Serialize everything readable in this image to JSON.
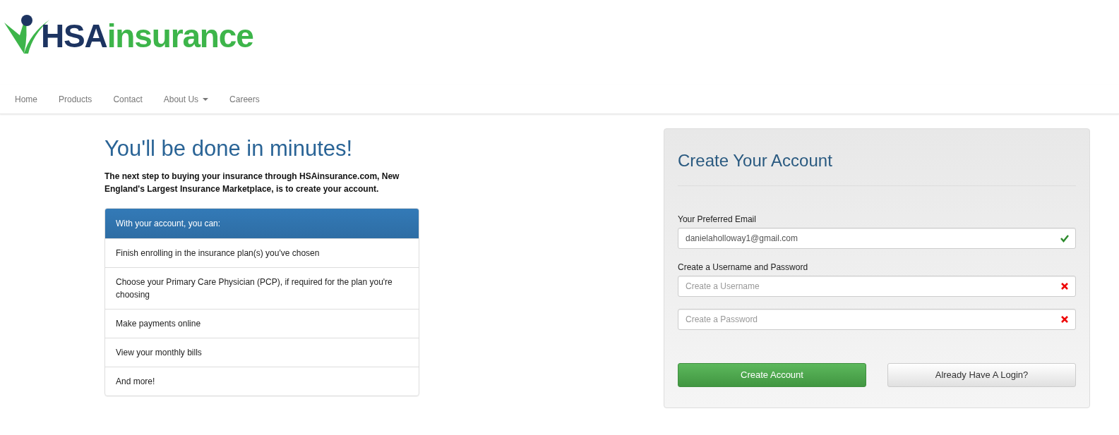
{
  "logo": {
    "brand_primary": "HSA",
    "brand_secondary": "insurance"
  },
  "nav": [
    {
      "label": "Home",
      "dropdown": false
    },
    {
      "label": "Products",
      "dropdown": false
    },
    {
      "label": "Contact",
      "dropdown": false
    },
    {
      "label": "About Us",
      "dropdown": true
    },
    {
      "label": "Careers",
      "dropdown": false
    }
  ],
  "intro": {
    "title": "You'll be done in minutes!",
    "text": "The next step to buying your insurance through HSAinsurance.com, New England's Largest Insurance Marketplace, is to create your account."
  },
  "benefits": {
    "heading": "With your account, you can:",
    "items": [
      "Finish enrolling in the insurance plan(s) you've chosen",
      "Choose your Primary Care Physician (PCP), if required for the plan you're choosing",
      "Make payments online",
      "View your monthly bills",
      "And more!"
    ]
  },
  "account_form": {
    "title": "Create Your Account",
    "fields": [
      {
        "label": "Your Preferred Email",
        "value": "danielaholloway1@gmail.com",
        "valid": true
      },
      {
        "label": "Create a Username and Password",
        "placeholder": "Create a Username",
        "valid": false
      },
      {
        "placeholder": "Create a Password",
        "valid": false
      }
    ],
    "buttons": [
      {
        "label": "Create Account",
        "kind": "primary"
      },
      {
        "label": "Already Have A Login?",
        "kind": "secondary"
      }
    ]
  }
}
